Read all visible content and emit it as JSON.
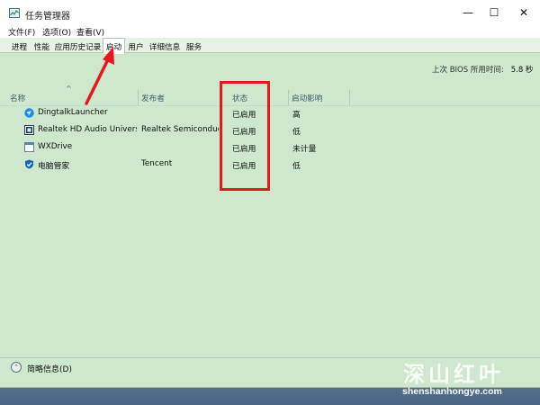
{
  "window": {
    "title": "任务管理器"
  },
  "window_controls": {
    "minimize": "—",
    "maximize": "☐",
    "close": "✕"
  },
  "menu": [
    "文件(F)",
    "选项(O)",
    "查看(V)"
  ],
  "tabs": [
    {
      "label": "进程",
      "active": false
    },
    {
      "label": "性能",
      "active": false
    },
    {
      "label": "应用历史记录",
      "active": false
    },
    {
      "label": "启动",
      "active": true
    },
    {
      "label": "用户",
      "active": false
    },
    {
      "label": "详细信息",
      "active": false
    },
    {
      "label": "服务",
      "active": false
    }
  ],
  "bios": {
    "label": "上次 BIOS 所用时间:",
    "value": "5.8 秒"
  },
  "columns": {
    "name": "名称",
    "publisher": "发布者",
    "status": "状态",
    "impact": "启动影响"
  },
  "rows": [
    {
      "icon": "dingtalk-icon",
      "name": "DingtalkLauncher",
      "publisher": "",
      "status": "已启用",
      "impact": "高"
    },
    {
      "icon": "realtek-audio-icon",
      "name": "Realtek HD Audio Univers...",
      "publisher": "Realtek Semiconductor",
      "status": "已启用",
      "impact": "低"
    },
    {
      "icon": "generic-app-icon",
      "name": "WXDrive",
      "publisher": "",
      "status": "已启用",
      "impact": "未计量"
    },
    {
      "icon": "tencent-pc-manager-icon",
      "name": "电脑管家",
      "publisher": "Tencent",
      "status": "已启用",
      "impact": "低"
    }
  ],
  "footer": {
    "label": "简略信息(D)",
    "toggle_icon": "chevron-up-icon"
  },
  "watermark": {
    "brand": "深山红叶",
    "url": "shenshanhongye.com"
  },
  "colors": {
    "window_bg": "#cde8cc",
    "annotation_red": "#e8171c",
    "header_text": "#3f5b72"
  }
}
